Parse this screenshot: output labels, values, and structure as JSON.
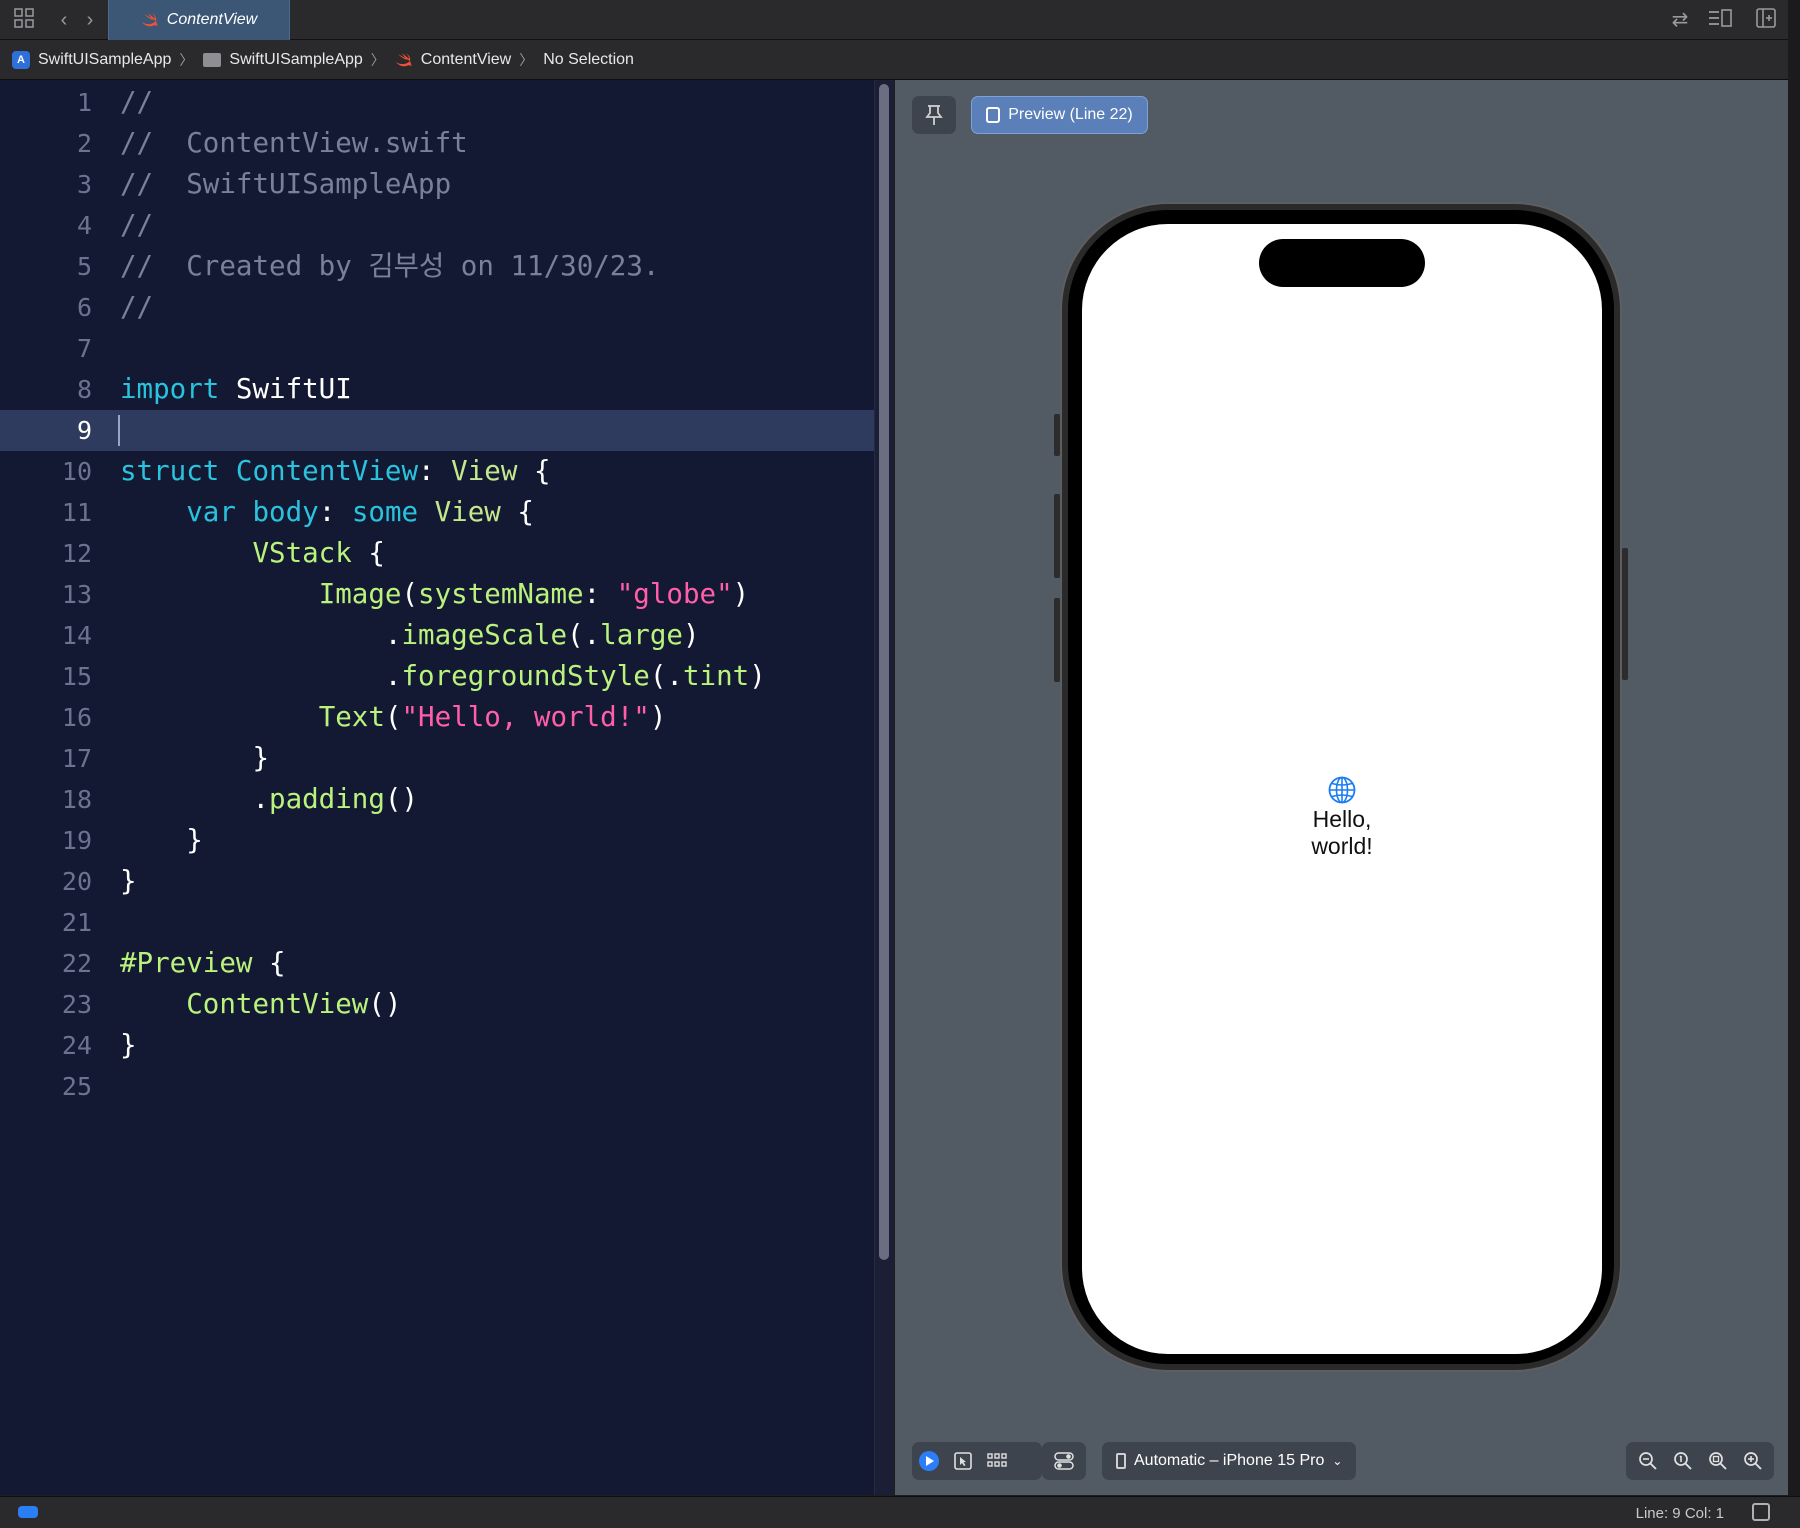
{
  "tabbar": {
    "active_tab": "ContentView"
  },
  "breadcrumb": {
    "project": "SwiftUISampleApp",
    "folder": "SwiftUISampleApp",
    "file": "ContentView",
    "selection": "No Selection"
  },
  "editor": {
    "active_line": 9,
    "lines": [
      {
        "n": "1",
        "tokens": [
          {
            "t": "//",
            "k": "com"
          }
        ]
      },
      {
        "n": "2",
        "tokens": [
          {
            "t": "//  ContentView.swift",
            "k": "com"
          }
        ]
      },
      {
        "n": "3",
        "tokens": [
          {
            "t": "//  SwiftUISampleApp",
            "k": "com"
          }
        ]
      },
      {
        "n": "4",
        "tokens": [
          {
            "t": "//",
            "k": "com"
          }
        ]
      },
      {
        "n": "5",
        "tokens": [
          {
            "t": "//  Created by 김부성 on 11/30/23.",
            "k": "com"
          }
        ]
      },
      {
        "n": "6",
        "tokens": [
          {
            "t": "//",
            "k": "com"
          }
        ]
      },
      {
        "n": "7",
        "tokens": []
      },
      {
        "n": "8",
        "tokens": [
          {
            "t": "import",
            "k": "kw"
          },
          {
            "t": " SwiftUI",
            "k": "plain"
          }
        ]
      },
      {
        "n": "9",
        "tokens": []
      },
      {
        "n": "10",
        "tokens": [
          {
            "t": "struct",
            "k": "kw"
          },
          {
            "t": " ",
            "k": "plain"
          },
          {
            "t": "ContentView",
            "k": "kw"
          },
          {
            "t": ": ",
            "k": "plain"
          },
          {
            "t": "View",
            "k": "ty"
          },
          {
            "t": " {",
            "k": "plain"
          }
        ]
      },
      {
        "n": "11",
        "tokens": [
          {
            "t": "    ",
            "k": "plain"
          },
          {
            "t": "var",
            "k": "kw"
          },
          {
            "t": " ",
            "k": "plain"
          },
          {
            "t": "body",
            "k": "kw"
          },
          {
            "t": ": ",
            "k": "plain"
          },
          {
            "t": "some",
            "k": "kw"
          },
          {
            "t": " ",
            "k": "plain"
          },
          {
            "t": "View",
            "k": "ty"
          },
          {
            "t": " {",
            "k": "plain"
          }
        ]
      },
      {
        "n": "12",
        "tokens": [
          {
            "t": "        ",
            "k": "plain"
          },
          {
            "t": "VStack",
            "k": "fn"
          },
          {
            "t": " {",
            "k": "plain"
          }
        ]
      },
      {
        "n": "13",
        "tokens": [
          {
            "t": "            ",
            "k": "plain"
          },
          {
            "t": "Image",
            "k": "fn"
          },
          {
            "t": "(",
            "k": "plain"
          },
          {
            "t": "systemName",
            "k": "fn"
          },
          {
            "t": ": ",
            "k": "plain"
          },
          {
            "t": "\"globe\"",
            "k": "str"
          },
          {
            "t": ")",
            "k": "plain"
          }
        ]
      },
      {
        "n": "14",
        "tokens": [
          {
            "t": "                .",
            "k": "plain"
          },
          {
            "t": "imageScale",
            "k": "fn"
          },
          {
            "t": "(.",
            "k": "plain"
          },
          {
            "t": "large",
            "k": "fn"
          },
          {
            "t": ")",
            "k": "plain"
          }
        ]
      },
      {
        "n": "15",
        "tokens": [
          {
            "t": "                .",
            "k": "plain"
          },
          {
            "t": "foregroundStyle",
            "k": "fn"
          },
          {
            "t": "(.",
            "k": "plain"
          },
          {
            "t": "tint",
            "k": "fn"
          },
          {
            "t": ")",
            "k": "plain"
          }
        ]
      },
      {
        "n": "16",
        "tokens": [
          {
            "t": "            ",
            "k": "plain"
          },
          {
            "t": "Text",
            "k": "fn"
          },
          {
            "t": "(",
            "k": "plain"
          },
          {
            "t": "\"Hello, world!\"",
            "k": "str"
          },
          {
            "t": ")",
            "k": "plain"
          }
        ]
      },
      {
        "n": "17",
        "tokens": [
          {
            "t": "        }",
            "k": "plain"
          }
        ]
      },
      {
        "n": "18",
        "tokens": [
          {
            "t": "        .",
            "k": "plain"
          },
          {
            "t": "padding",
            "k": "fn"
          },
          {
            "t": "()",
            "k": "plain"
          }
        ]
      },
      {
        "n": "19",
        "tokens": [
          {
            "t": "    }",
            "k": "plain"
          }
        ]
      },
      {
        "n": "20",
        "tokens": [
          {
            "t": "}",
            "k": "plain"
          }
        ]
      },
      {
        "n": "21",
        "tokens": []
      },
      {
        "n": "22",
        "tokens": [
          {
            "t": "#Preview",
            "k": "fn"
          },
          {
            "t": " {",
            "k": "plain"
          }
        ]
      },
      {
        "n": "23",
        "tokens": [
          {
            "t": "    ",
            "k": "plain"
          },
          {
            "t": "ContentView",
            "k": "fn"
          },
          {
            "t": "()",
            "k": "plain"
          }
        ]
      },
      {
        "n": "24",
        "tokens": [
          {
            "t": "}",
            "k": "plain"
          }
        ]
      },
      {
        "n": "25",
        "tokens": []
      }
    ]
  },
  "preview": {
    "label": "Preview (Line 22)",
    "hello_text": "Hello, world!",
    "device_label": "Automatic – iPhone 15 Pro"
  },
  "statusbar": {
    "position": "Line: 9  Col: 1"
  },
  "colors": {
    "editor_bg": "#131833",
    "comment": "#7a8099",
    "keyword": "#2ac3de",
    "function": "#b9f27c",
    "string": "#ff5fa9",
    "accent": "#2c7ef8"
  }
}
